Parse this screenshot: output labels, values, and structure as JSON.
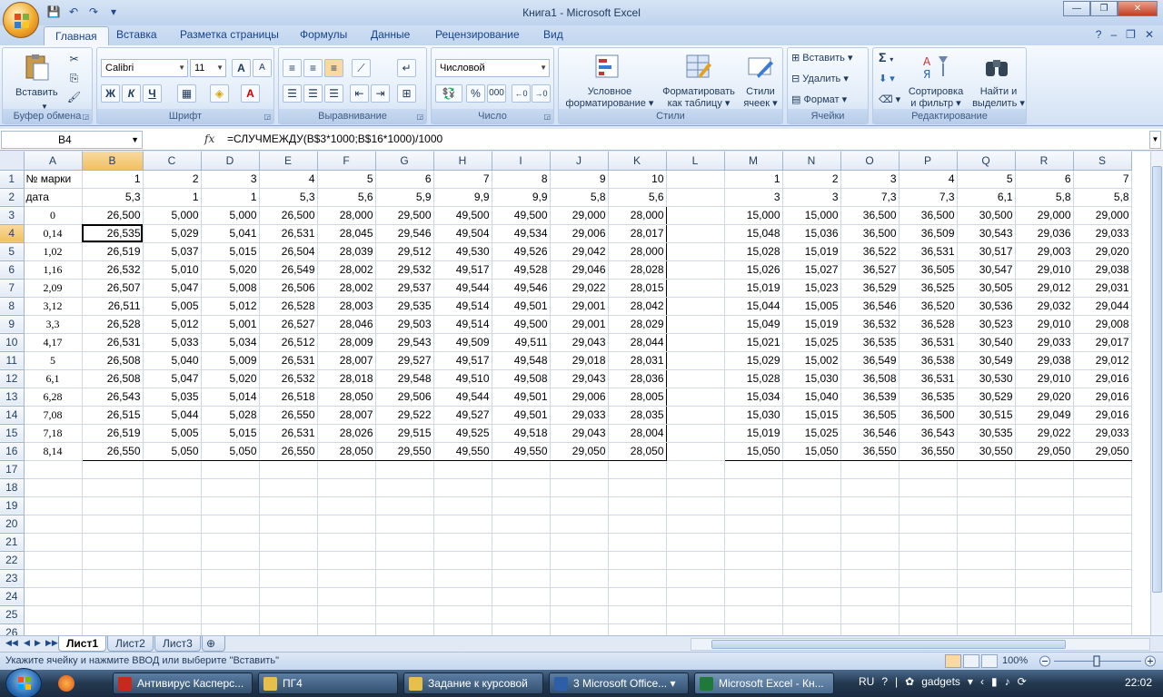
{
  "app": {
    "title": "Книга1 - Microsoft Excel",
    "window_buttons": [
      "—",
      "❐",
      "✕"
    ]
  },
  "ribbon": {
    "tabs": [
      "Главная",
      "Вставка",
      "Разметка страницы",
      "Формулы",
      "Данные",
      "Рецензирование",
      "Вид"
    ],
    "active_tab": "Главная",
    "groups": {
      "clipboard": {
        "label": "Буфер обмена",
        "paste": "Вставить"
      },
      "font": {
        "label": "Шрифт",
        "font_name": "Calibri",
        "font_size": "11",
        "bold": "Ж",
        "italic": "К",
        "underline": "Ч",
        "grow": "A",
        "shrink": "A"
      },
      "alignment": {
        "label": "Выравнивание"
      },
      "number": {
        "label": "Число",
        "format": "Числовой",
        "percent": "%",
        "thousands": "000"
      },
      "styles": {
        "label": "Стили",
        "conditional_1": "Условное",
        "conditional_2": "форматирование",
        "format_table_1": "Форматировать",
        "format_table_2": "как таблицу",
        "cell_styles_1": "Стили",
        "cell_styles_2": "ячеек"
      },
      "cells": {
        "label": "Ячейки",
        "insert": "Вставить",
        "delete": "Удалить",
        "format": "Формат"
      },
      "editing": {
        "label": "Редактирование",
        "sigma": "Σ",
        "sort_1": "Сортировка",
        "sort_2": "и фильтр",
        "find_1": "Найти и",
        "find_2": "выделить"
      }
    }
  },
  "formula_bar": {
    "name_box": "B4",
    "fx": "fx",
    "formula": "=СЛУЧМЕЖДУ(B$3*1000;B$16*1000)/1000"
  },
  "sheet": {
    "columns": [
      "A",
      "B",
      "C",
      "D",
      "E",
      "F",
      "G",
      "H",
      "I",
      "J",
      "K",
      "L",
      "M",
      "N",
      "O",
      "P",
      "Q",
      "R",
      "S"
    ],
    "selected_column": "B",
    "selected_row": "4",
    "active_cell": "B4",
    "rows": [
      {
        "n": "1",
        "cells": [
          "№ марки",
          "1",
          "2",
          "3",
          "4",
          "5",
          "6",
          "7",
          "8",
          "9",
          "10",
          "",
          "1",
          "2",
          "3",
          "4",
          "5",
          "6",
          "7"
        ]
      },
      {
        "n": "2",
        "cells": [
          "дата",
          "5,3",
          "1",
          "1",
          "5,3",
          "5,6",
          "5,9",
          "9,9",
          "9,9",
          "5,8",
          "5,6",
          "",
          "3",
          "3",
          "7,3",
          "7,3",
          "6,1",
          "5,8",
          "5,8"
        ]
      },
      {
        "n": "3",
        "cells": [
          "0",
          "26,500",
          "5,000",
          "5,000",
          "26,500",
          "28,000",
          "29,500",
          "49,500",
          "49,500",
          "29,000",
          "28,000",
          "",
          "15,000",
          "15,000",
          "36,500",
          "36,500",
          "30,500",
          "29,000",
          "29,000"
        ]
      },
      {
        "n": "4",
        "cells": [
          "0,14",
          "26,535",
          "5,029",
          "5,041",
          "26,531",
          "28,045",
          "29,546",
          "49,504",
          "49,534",
          "29,006",
          "28,017",
          "",
          "15,048",
          "15,036",
          "36,500",
          "36,509",
          "30,543",
          "29,036",
          "29,033"
        ]
      },
      {
        "n": "5",
        "cells": [
          "1,02",
          "26,519",
          "5,037",
          "5,015",
          "26,504",
          "28,039",
          "29,512",
          "49,530",
          "49,526",
          "29,042",
          "28,000",
          "",
          "15,028",
          "15,019",
          "36,522",
          "36,531",
          "30,517",
          "29,003",
          "29,020"
        ]
      },
      {
        "n": "6",
        "cells": [
          "1,16",
          "26,532",
          "5,010",
          "5,020",
          "26,549",
          "28,002",
          "29,532",
          "49,517",
          "49,528",
          "29,046",
          "28,028",
          "",
          "15,026",
          "15,027",
          "36,527",
          "36,505",
          "30,547",
          "29,010",
          "29,038"
        ]
      },
      {
        "n": "7",
        "cells": [
          "2,09",
          "26,507",
          "5,047",
          "5,008",
          "26,506",
          "28,002",
          "29,537",
          "49,544",
          "49,546",
          "29,022",
          "28,015",
          "",
          "15,019",
          "15,023",
          "36,529",
          "36,525",
          "30,505",
          "29,012",
          "29,031"
        ]
      },
      {
        "n": "8",
        "cells": [
          "3,12",
          "26,511",
          "5,005",
          "5,012",
          "26,528",
          "28,003",
          "29,535",
          "49,514",
          "49,501",
          "29,001",
          "28,042",
          "",
          "15,044",
          "15,005",
          "36,546",
          "36,520",
          "30,536",
          "29,032",
          "29,044"
        ]
      },
      {
        "n": "9",
        "cells": [
          "3,3",
          "26,528",
          "5,012",
          "5,001",
          "26,527",
          "28,046",
          "29,503",
          "49,514",
          "49,500",
          "29,001",
          "28,029",
          "",
          "15,049",
          "15,019",
          "36,532",
          "36,528",
          "30,523",
          "29,010",
          "29,008"
        ]
      },
      {
        "n": "10",
        "cells": [
          "4,17",
          "26,531",
          "5,033",
          "5,034",
          "26,512",
          "28,009",
          "29,543",
          "49,509",
          "49,511",
          "29,043",
          "28,044",
          "",
          "15,021",
          "15,025",
          "36,535",
          "36,531",
          "30,540",
          "29,033",
          "29,017"
        ]
      },
      {
        "n": "11",
        "cells": [
          "5",
          "26,508",
          "5,040",
          "5,009",
          "26,531",
          "28,007",
          "29,527",
          "49,517",
          "49,548",
          "29,018",
          "28,031",
          "",
          "15,029",
          "15,002",
          "36,549",
          "36,538",
          "30,549",
          "29,038",
          "29,012"
        ]
      },
      {
        "n": "12",
        "cells": [
          "6,1",
          "26,508",
          "5,047",
          "5,020",
          "26,532",
          "28,018",
          "29,548",
          "49,510",
          "49,508",
          "29,043",
          "28,036",
          "",
          "15,028",
          "15,030",
          "36,508",
          "36,531",
          "30,530",
          "29,010",
          "29,016"
        ]
      },
      {
        "n": "13",
        "cells": [
          "6,28",
          "26,543",
          "5,035",
          "5,014",
          "26,518",
          "28,050",
          "29,506",
          "49,544",
          "49,501",
          "29,006",
          "28,005",
          "",
          "15,034",
          "15,040",
          "36,539",
          "36,535",
          "30,529",
          "29,020",
          "29,016"
        ]
      },
      {
        "n": "14",
        "cells": [
          "7,08",
          "26,515",
          "5,044",
          "5,028",
          "26,550",
          "28,007",
          "29,522",
          "49,527",
          "49,501",
          "29,033",
          "28,035",
          "",
          "15,030",
          "15,015",
          "36,505",
          "36,500",
          "30,515",
          "29,049",
          "29,016"
        ]
      },
      {
        "n": "15",
        "cells": [
          "7,18",
          "26,519",
          "5,005",
          "5,015",
          "26,531",
          "28,026",
          "29,515",
          "49,525",
          "49,518",
          "29,043",
          "28,004",
          "",
          "15,019",
          "15,025",
          "36,546",
          "36,543",
          "30,535",
          "29,022",
          "29,033"
        ]
      },
      {
        "n": "16",
        "cells": [
          "8,14",
          "26,550",
          "5,050",
          "5,050",
          "26,550",
          "28,050",
          "29,550",
          "49,550",
          "49,550",
          "29,050",
          "28,050",
          "",
          "15,050",
          "15,050",
          "36,550",
          "36,550",
          "30,550",
          "29,050",
          "29,050"
        ]
      },
      {
        "n": "17",
        "cells": [
          "",
          "",
          "",
          "",
          "",
          "",
          "",
          "",
          "",
          "",
          "",
          "",
          "",
          "",
          "",
          "",
          "",
          "",
          ""
        ]
      },
      {
        "n": "18",
        "cells": [
          "",
          "",
          "",
          "",
          "",
          "",
          "",
          "",
          "",
          "",
          "",
          "",
          "",
          "",
          "",
          "",
          "",
          "",
          ""
        ]
      },
      {
        "n": "19",
        "cells": [
          "",
          "",
          "",
          "",
          "",
          "",
          "",
          "",
          "",
          "",
          "",
          "",
          "",
          "",
          "",
          "",
          "",
          "",
          ""
        ]
      },
      {
        "n": "20",
        "cells": [
          "",
          "",
          "",
          "",
          "",
          "",
          "",
          "",
          "",
          "",
          "",
          "",
          "",
          "",
          "",
          "",
          "",
          "",
          ""
        ]
      },
      {
        "n": "21",
        "cells": [
          "",
          "",
          "",
          "",
          "",
          "",
          "",
          "",
          "",
          "",
          "",
          "",
          "",
          "",
          "",
          "",
          "",
          "",
          ""
        ]
      },
      {
        "n": "22",
        "cells": [
          "",
          "",
          "",
          "",
          "",
          "",
          "",
          "",
          "",
          "",
          "",
          "",
          "",
          "",
          "",
          "",
          "",
          "",
          ""
        ]
      },
      {
        "n": "23",
        "cells": [
          "",
          "",
          "",
          "",
          "",
          "",
          "",
          "",
          "",
          "",
          "",
          "",
          "",
          "",
          "",
          "",
          "",
          "",
          ""
        ]
      },
      {
        "n": "24",
        "cells": [
          "",
          "",
          "",
          "",
          "",
          "",
          "",
          "",
          "",
          "",
          "",
          "",
          "",
          "",
          "",
          "",
          "",
          "",
          ""
        ]
      },
      {
        "n": "25",
        "cells": [
          "",
          "",
          "",
          "",
          "",
          "",
          "",
          "",
          "",
          "",
          "",
          "",
          "",
          "",
          "",
          "",
          "",
          "",
          ""
        ]
      },
      {
        "n": "26",
        "cells": [
          "",
          "",
          "",
          "",
          "",
          "",
          "",
          "",
          "",
          "",
          "",
          "",
          "",
          "",
          "",
          "",
          "",
          "",
          ""
        ]
      }
    ]
  },
  "sheet_tabs": [
    "Лист1",
    "Лист2",
    "Лист3"
  ],
  "active_sheet": "Лист1",
  "status": {
    "message": "Укажите ячейку и нажмите ВВОД или выберите \"Вставить\"",
    "zoom": "100%"
  },
  "taskbar": {
    "items": [
      {
        "label": "Антивирус Касперс...",
        "color": "#c8281e"
      },
      {
        "label": "ПГ4",
        "color": "#e5c04a"
      },
      {
        "label": "Задание к курсовой",
        "color": "#e5c04a"
      },
      {
        "label": "3 Microsoft Office...",
        "color": "#2d5ea8"
      },
      {
        "label": "Microsoft Excel - Кн...",
        "color": "#1f7a3a"
      }
    ],
    "lang": "RU",
    "gadgets": "gadgets",
    "clock": "22:02"
  },
  "colors": {
    "selection_header": "#f1c15f",
    "ribbon_text": "#15428b"
  }
}
